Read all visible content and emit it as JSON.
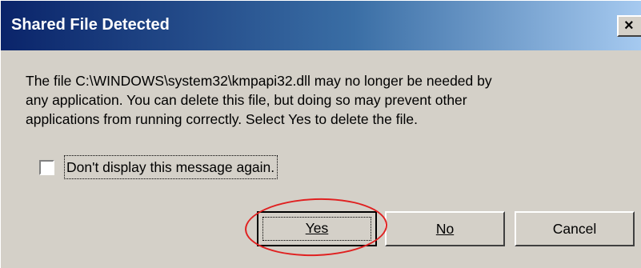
{
  "window": {
    "title": "Shared File Detected",
    "close_glyph": "×"
  },
  "message": {
    "line1": "The file C:\\WINDOWS\\system32\\kmpapi32.dll may no longer be needed by",
    "line2": "any application. You can delete this file, but doing so may prevent other",
    "line3": "applications from running correctly.  Select Yes to delete the file."
  },
  "checkbox": {
    "label": "Don't display this message again.",
    "checked": false
  },
  "buttons": {
    "yes_label": "Yes",
    "no_label": "No",
    "cancel_label": "Cancel"
  },
  "annotation": {
    "highlight_color": "#e02020"
  },
  "colors": {
    "titlebar_start": "#0a246a",
    "titlebar_end": "#a6caf0",
    "dialog_face": "#d4d0c8"
  }
}
